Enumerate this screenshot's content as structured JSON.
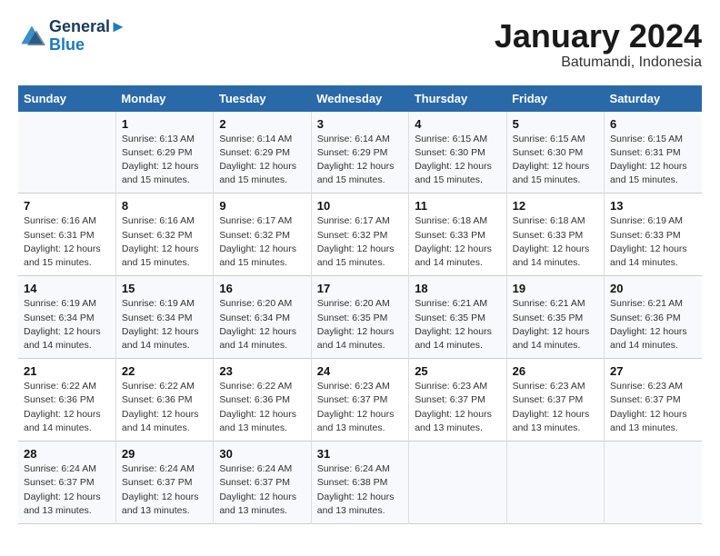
{
  "header": {
    "logo_line1": "General",
    "logo_line2": "Blue",
    "month_title": "January 2024",
    "subtitle": "Batumandi, Indonesia"
  },
  "weekdays": [
    "Sunday",
    "Monday",
    "Tuesday",
    "Wednesday",
    "Thursday",
    "Friday",
    "Saturday"
  ],
  "weeks": [
    [
      {
        "date": "",
        "info": ""
      },
      {
        "date": "1",
        "info": "Sunrise: 6:13 AM\nSunset: 6:29 PM\nDaylight: 12 hours\nand 15 minutes."
      },
      {
        "date": "2",
        "info": "Sunrise: 6:14 AM\nSunset: 6:29 PM\nDaylight: 12 hours\nand 15 minutes."
      },
      {
        "date": "3",
        "info": "Sunrise: 6:14 AM\nSunset: 6:29 PM\nDaylight: 12 hours\nand 15 minutes."
      },
      {
        "date": "4",
        "info": "Sunrise: 6:15 AM\nSunset: 6:30 PM\nDaylight: 12 hours\nand 15 minutes."
      },
      {
        "date": "5",
        "info": "Sunrise: 6:15 AM\nSunset: 6:30 PM\nDaylight: 12 hours\nand 15 minutes."
      },
      {
        "date": "6",
        "info": "Sunrise: 6:15 AM\nSunset: 6:31 PM\nDaylight: 12 hours\nand 15 minutes."
      }
    ],
    [
      {
        "date": "7",
        "info": "Sunrise: 6:16 AM\nSunset: 6:31 PM\nDaylight: 12 hours\nand 15 minutes."
      },
      {
        "date": "8",
        "info": "Sunrise: 6:16 AM\nSunset: 6:32 PM\nDaylight: 12 hours\nand 15 minutes."
      },
      {
        "date": "9",
        "info": "Sunrise: 6:17 AM\nSunset: 6:32 PM\nDaylight: 12 hours\nand 15 minutes."
      },
      {
        "date": "10",
        "info": "Sunrise: 6:17 AM\nSunset: 6:32 PM\nDaylight: 12 hours\nand 15 minutes."
      },
      {
        "date": "11",
        "info": "Sunrise: 6:18 AM\nSunset: 6:33 PM\nDaylight: 12 hours\nand 14 minutes."
      },
      {
        "date": "12",
        "info": "Sunrise: 6:18 AM\nSunset: 6:33 PM\nDaylight: 12 hours\nand 14 minutes."
      },
      {
        "date": "13",
        "info": "Sunrise: 6:19 AM\nSunset: 6:33 PM\nDaylight: 12 hours\nand 14 minutes."
      }
    ],
    [
      {
        "date": "14",
        "info": "Sunrise: 6:19 AM\nSunset: 6:34 PM\nDaylight: 12 hours\nand 14 minutes."
      },
      {
        "date": "15",
        "info": "Sunrise: 6:19 AM\nSunset: 6:34 PM\nDaylight: 12 hours\nand 14 minutes."
      },
      {
        "date": "16",
        "info": "Sunrise: 6:20 AM\nSunset: 6:34 PM\nDaylight: 12 hours\nand 14 minutes."
      },
      {
        "date": "17",
        "info": "Sunrise: 6:20 AM\nSunset: 6:35 PM\nDaylight: 12 hours\nand 14 minutes."
      },
      {
        "date": "18",
        "info": "Sunrise: 6:21 AM\nSunset: 6:35 PM\nDaylight: 12 hours\nand 14 minutes."
      },
      {
        "date": "19",
        "info": "Sunrise: 6:21 AM\nSunset: 6:35 PM\nDaylight: 12 hours\nand 14 minutes."
      },
      {
        "date": "20",
        "info": "Sunrise: 6:21 AM\nSunset: 6:36 PM\nDaylight: 12 hours\nand 14 minutes."
      }
    ],
    [
      {
        "date": "21",
        "info": "Sunrise: 6:22 AM\nSunset: 6:36 PM\nDaylight: 12 hours\nand 14 minutes."
      },
      {
        "date": "22",
        "info": "Sunrise: 6:22 AM\nSunset: 6:36 PM\nDaylight: 12 hours\nand 14 minutes."
      },
      {
        "date": "23",
        "info": "Sunrise: 6:22 AM\nSunset: 6:36 PM\nDaylight: 12 hours\nand 13 minutes."
      },
      {
        "date": "24",
        "info": "Sunrise: 6:23 AM\nSunset: 6:37 PM\nDaylight: 12 hours\nand 13 minutes."
      },
      {
        "date": "25",
        "info": "Sunrise: 6:23 AM\nSunset: 6:37 PM\nDaylight: 12 hours\nand 13 minutes."
      },
      {
        "date": "26",
        "info": "Sunrise: 6:23 AM\nSunset: 6:37 PM\nDaylight: 12 hours\nand 13 minutes."
      },
      {
        "date": "27",
        "info": "Sunrise: 6:23 AM\nSunset: 6:37 PM\nDaylight: 12 hours\nand 13 minutes."
      }
    ],
    [
      {
        "date": "28",
        "info": "Sunrise: 6:24 AM\nSunset: 6:37 PM\nDaylight: 12 hours\nand 13 minutes."
      },
      {
        "date": "29",
        "info": "Sunrise: 6:24 AM\nSunset: 6:37 PM\nDaylight: 12 hours\nand 13 minutes."
      },
      {
        "date": "30",
        "info": "Sunrise: 6:24 AM\nSunset: 6:37 PM\nDaylight: 12 hours\nand 13 minutes."
      },
      {
        "date": "31",
        "info": "Sunrise: 6:24 AM\nSunset: 6:38 PM\nDaylight: 12 hours\nand 13 minutes."
      },
      {
        "date": "",
        "info": ""
      },
      {
        "date": "",
        "info": ""
      },
      {
        "date": "",
        "info": ""
      }
    ]
  ]
}
